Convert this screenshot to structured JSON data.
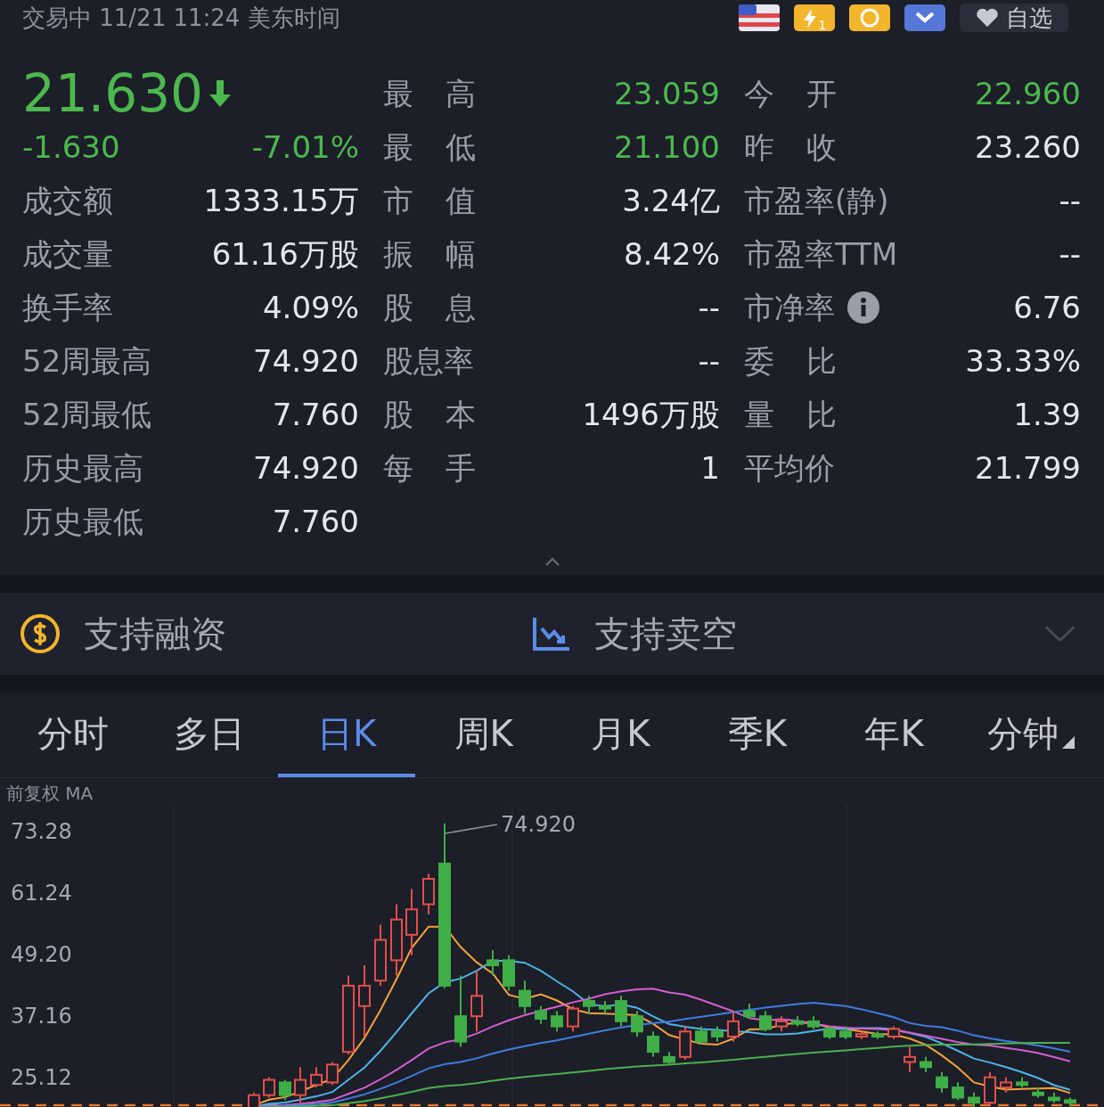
{
  "status": {
    "text": "交易中 11/21 11:24 美东时间",
    "icon_badge": "1",
    "watch_button": "自选"
  },
  "quote": {
    "price": "21.630",
    "falling": true,
    "change": "-1.630",
    "change_pct": "-7.01%"
  },
  "left_stats": [
    {
      "label": "成交额",
      "value": "1333.15万"
    },
    {
      "label": "成交量",
      "value": "61.16万股"
    },
    {
      "label": "换手率",
      "value": "4.09%"
    },
    {
      "label": "52周最高",
      "value": "74.920"
    },
    {
      "label": "52周最低",
      "value": "7.760"
    },
    {
      "label": "历史最高",
      "value": "74.920"
    },
    {
      "label": "历史最低",
      "value": "7.760"
    }
  ],
  "mid_stats": [
    {
      "label": "最高",
      "value": "23.059",
      "falling": true
    },
    {
      "label": "最低",
      "value": "21.100",
      "falling": true
    },
    {
      "label": "市值",
      "value": "3.24亿",
      "falling": false
    },
    {
      "label": "振幅",
      "value": "8.42%",
      "falling": false
    },
    {
      "label": "股息",
      "value": "--",
      "falling": false
    },
    {
      "label": "股息率",
      "value": "--",
      "falling": false
    },
    {
      "label": "股本",
      "value": "1496万股",
      "falling": false
    },
    {
      "label": "每手",
      "value": "1",
      "falling": false
    }
  ],
  "right_stats": [
    {
      "label": "今开",
      "value": "22.960",
      "falling": true,
      "info": false
    },
    {
      "label": "昨收",
      "value": "23.260",
      "falling": false,
      "info": false
    },
    {
      "label": "市盈率(静)",
      "value": "--",
      "falling": false,
      "info": false
    },
    {
      "label": "市盈率TTM",
      "value": "--",
      "falling": false,
      "info": false
    },
    {
      "label": "市净率",
      "value": "6.76",
      "falling": false,
      "info": true
    },
    {
      "label": "委比",
      "value": "33.33%",
      "falling": false,
      "info": false
    },
    {
      "label": "量比",
      "value": "1.39",
      "falling": false,
      "info": false
    },
    {
      "label": "平均价",
      "value": "21.799",
      "falling": false,
      "info": false
    }
  ],
  "features": [
    {
      "kind": "margin",
      "label": "支持融资"
    },
    {
      "kind": "short",
      "label": "支持卖空"
    }
  ],
  "tabs": [
    {
      "label": "分时",
      "selected": false,
      "menu": false
    },
    {
      "label": "多日",
      "selected": false,
      "menu": false
    },
    {
      "label": "日K",
      "selected": true,
      "menu": false
    },
    {
      "label": "周K",
      "selected": false,
      "menu": false
    },
    {
      "label": "月K",
      "selected": false,
      "menu": false
    },
    {
      "label": "季K",
      "selected": false,
      "menu": false
    },
    {
      "label": "年K",
      "selected": false,
      "menu": false
    },
    {
      "label": "分钟",
      "selected": false,
      "menu": true
    }
  ],
  "chart": {
    "mode_label": "前复权 MA",
    "y_labels": [
      "73.28",
      "61.24",
      "49.20",
      "37.16",
      "25.12"
    ],
    "peak_label": "74.920"
  }
}
